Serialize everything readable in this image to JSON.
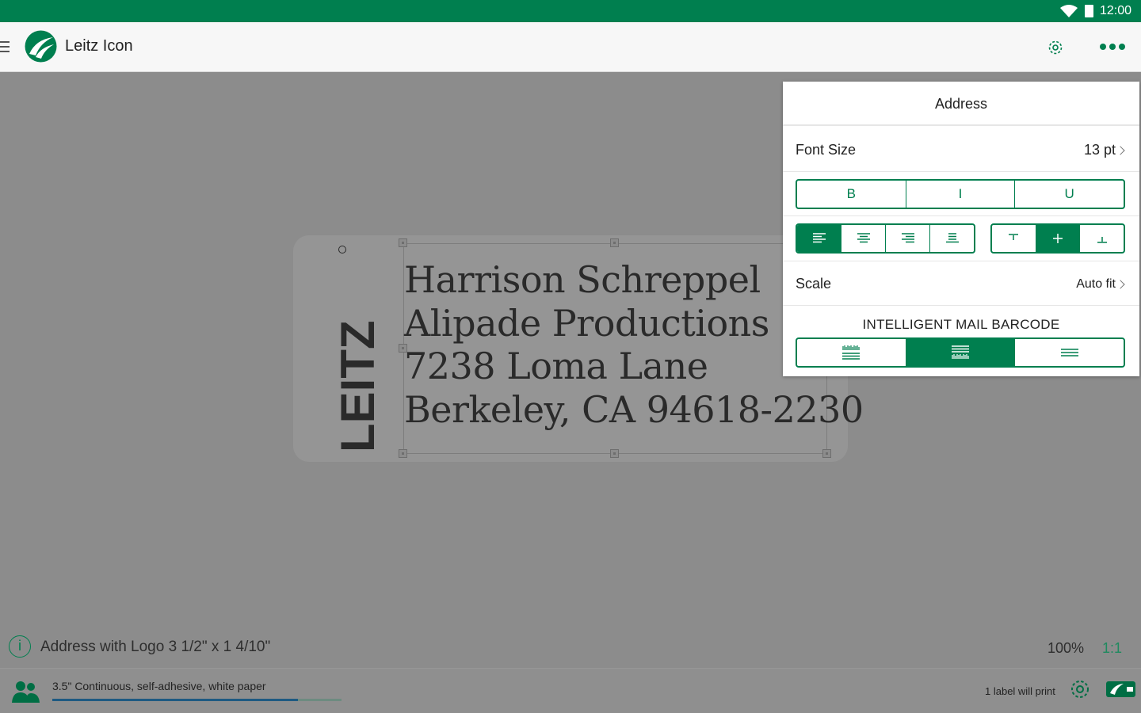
{
  "status_bar": {
    "time": "12:00"
  },
  "app_bar": {
    "title": "Leitz Icon"
  },
  "label": {
    "logo_text": "LEITZ",
    "address_lines": [
      "Harrison Schreppel",
      "Alipade Productions",
      "7238 Loma Lane",
      "Berkeley, CA 94618-2230"
    ]
  },
  "info": {
    "info_glyph": "i",
    "template_name": "Address with Logo 3 1/2\" x 1 4/10\"",
    "zoom": "100%",
    "ratio": "1:1"
  },
  "bottom_bar": {
    "media": "3.5\" Continuous, self-adhesive, white paper",
    "media_progress": 0.85,
    "print_count": "1 label will print"
  },
  "panel": {
    "title": "Address",
    "font_size_label": "Font Size",
    "font_size_value": "13 pt",
    "style_buttons": [
      "B",
      "I",
      "U"
    ],
    "horizontal_align_icons": [
      "align-left-icon",
      "align-center-icon",
      "align-right-icon",
      "align-justify-icon"
    ],
    "horizontal_align_selected": 0,
    "vertical_align_icons": [
      "align-top-icon",
      "align-middle-icon",
      "align-bottom-icon"
    ],
    "vertical_align_selected": 1,
    "scale_label": "Scale",
    "scale_value": "Auto fit",
    "barcode_title": "INTELLIGENT MAIL BARCODE",
    "barcode_options": [
      "barcode-above-text-icon",
      "barcode-below-text-icon",
      "no-barcode-icon"
    ],
    "barcode_selected": 1
  },
  "colors": {
    "accent": "#007f4f",
    "canvas": "#8c8c8c"
  }
}
